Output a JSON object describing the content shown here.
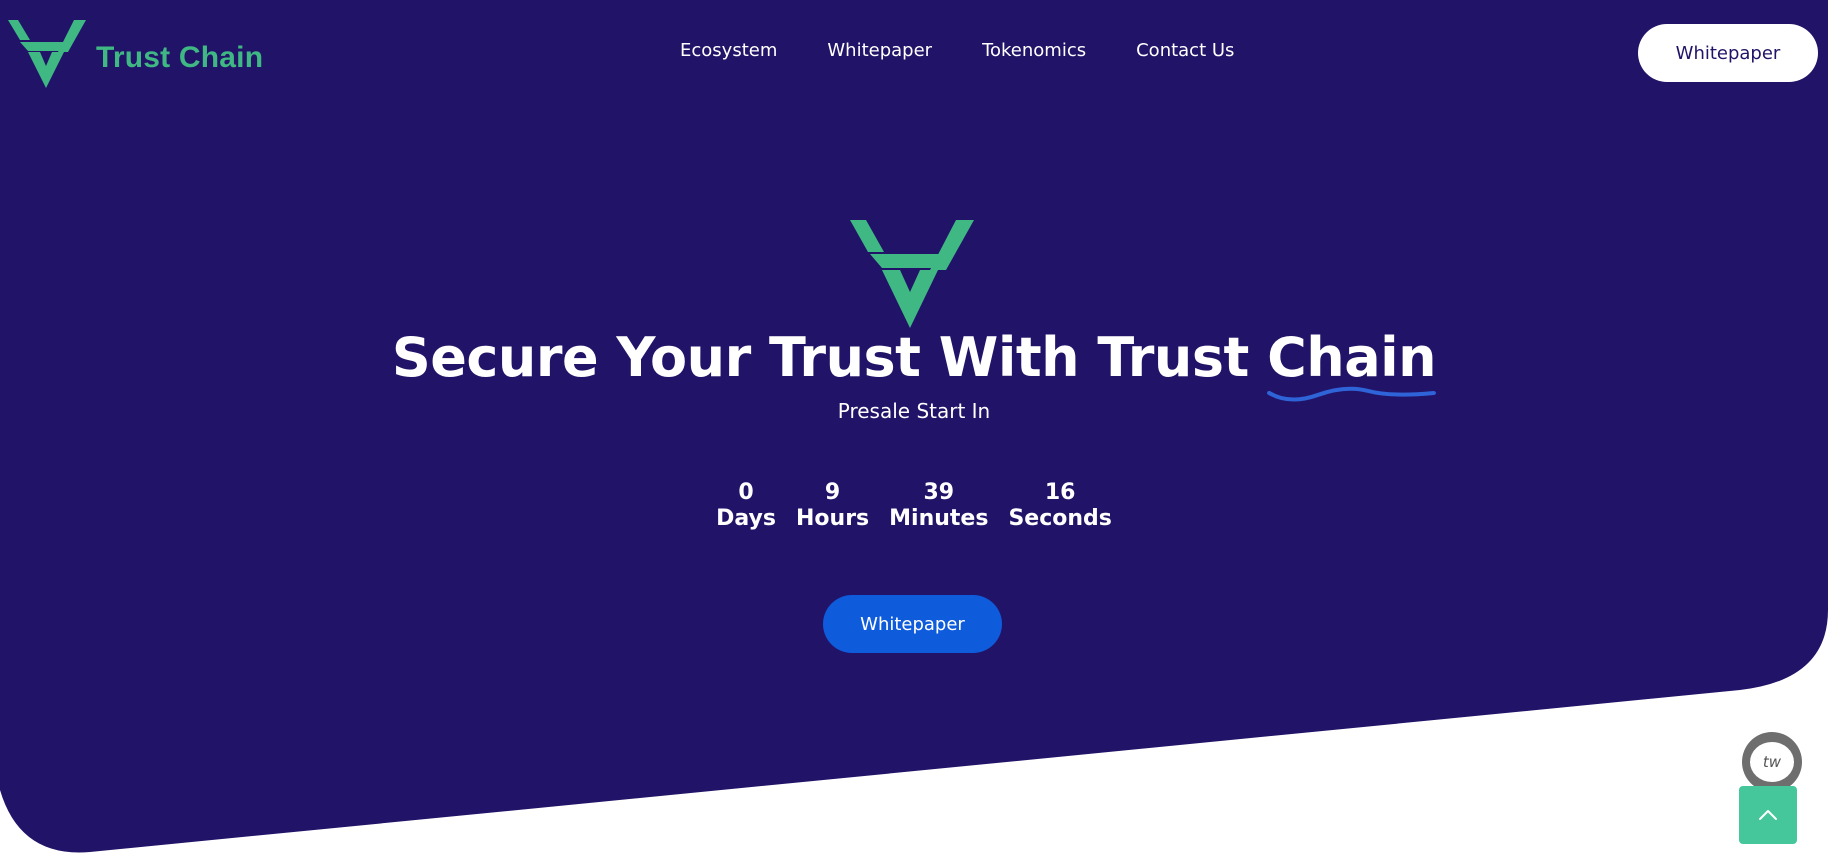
{
  "brand": {
    "name": "Trust Chain",
    "logo_icon": "trust-chain-v-logo",
    "color": "#3fb883"
  },
  "nav": {
    "items": [
      {
        "label": "Ecosystem"
      },
      {
        "label": "Whitepaper"
      },
      {
        "label": "Tokenomics"
      },
      {
        "label": "Contact Us"
      }
    ]
  },
  "header": {
    "cta_label": "Whitepaper"
  },
  "hero": {
    "title_main": "Secure Your Trust With Trust ",
    "title_highlight": "Chain",
    "subtitle": "Presale Start In",
    "cta_label": "Whitepaper",
    "background_color": "#211468",
    "cta_color": "#0e5bdc"
  },
  "countdown": {
    "units": [
      {
        "value": "0",
        "label": "Days"
      },
      {
        "value": "9",
        "label": "Hours"
      },
      {
        "value": "39",
        "label": "Minutes"
      },
      {
        "value": "16",
        "label": "Seconds"
      }
    ]
  },
  "widgets": {
    "chat_icon": "chat-bubble-icon",
    "chat_text": "tw",
    "scroll_top_icon": "chevron-up-icon"
  }
}
